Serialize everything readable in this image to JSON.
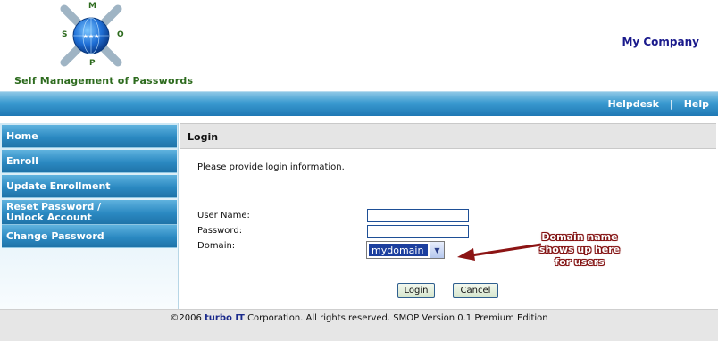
{
  "header": {
    "logo_letters": {
      "top": "M",
      "left": "S",
      "right": "O",
      "bottom": "P"
    },
    "logo_title": "Self Management of Passwords",
    "company": "My Company"
  },
  "topbar": {
    "links": [
      {
        "label": "Helpdesk"
      },
      {
        "label": "Help"
      }
    ],
    "separator": "|"
  },
  "sidebar": {
    "items": [
      {
        "label": "Home"
      },
      {
        "label": "Enroll"
      },
      {
        "label": "Update Enrollment"
      },
      {
        "label": "Reset Password /\nUnlock Account"
      },
      {
        "label": "Change Password"
      }
    ]
  },
  "panel": {
    "title": "Login",
    "instruction": "Please provide login information.",
    "fields": {
      "username_label": "User Name:",
      "username_value": "",
      "password_label": "Password:",
      "password_value": "",
      "domain_label": "Domain:",
      "domain_value": "mydomain"
    },
    "buttons": {
      "login": "Login",
      "cancel": "Cancel"
    }
  },
  "annotation": {
    "callout": "Domain name shows up here for users"
  },
  "footer": {
    "prefix": "©2006",
    "brand": "turbo IT",
    "suffix": "Corporation. All rights reserved. SMOP Version 0.1 Premium Edition"
  },
  "colors": {
    "nav_blue": "#2b89c2",
    "brand_green": "#2d6b1e",
    "company_blue": "#1a1a8c",
    "annotation_red": "#8c1414"
  }
}
